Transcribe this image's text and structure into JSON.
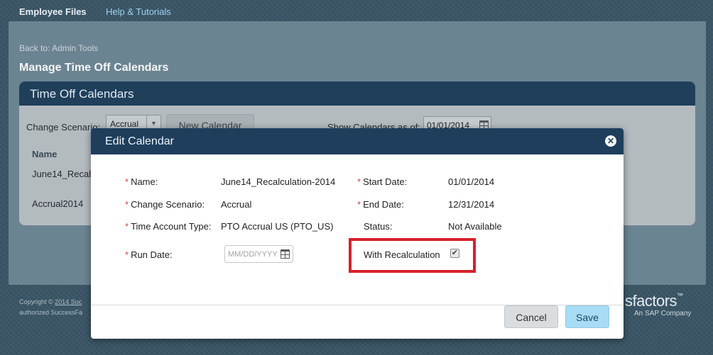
{
  "topbar": {
    "brand": "Employee Files",
    "help": "Help & Tutorials"
  },
  "page": {
    "back_link": "Back to: Admin Tools",
    "title": "Manage Time Off Calendars"
  },
  "panel": {
    "title": "Time Off Calendars",
    "change_scenario_label": "Change Scenario:",
    "change_scenario_value": "Accrual",
    "new_calendar_label": "New Calendar",
    "show_as_of_label": "Show Calendars as of:",
    "show_as_of_value": "01/01/2014",
    "name_header": "Name",
    "rows": [
      "June14_Recalc",
      "Accrual2014"
    ]
  },
  "footer": {
    "copyright_prefix": "Copyright ©",
    "copyright_link": "2014 Suc",
    "line2": "authorized SuccessFa",
    "logo_word": "sfactors",
    "logo_tagline": "An SAP Company"
  },
  "modal": {
    "title": "Edit Calendar",
    "close_glyph": "✕",
    "required_mark": "*",
    "fields": {
      "name": {
        "label": "Name:",
        "value": "June14_Recalculation-2014"
      },
      "change_scenario": {
        "label": "Change Scenario:",
        "value": "Accrual"
      },
      "time_account_type": {
        "label": "Time Account Type:",
        "value": "PTO Accrual US (PTO_US)"
      },
      "run_date": {
        "label": "Run Date:",
        "placeholder": "MM/DD/YYYY"
      },
      "start_date": {
        "label": "Start Date:",
        "value": "01/01/2014"
      },
      "end_date": {
        "label": "End Date:",
        "value": "12/31/2014"
      },
      "status": {
        "label": "Status:",
        "value": "Not Available"
      },
      "with_recalculation": {
        "label": "With Recalculation",
        "checked": true,
        "glyph": "✔"
      }
    },
    "cancel_label": "Cancel",
    "save_label": "Save"
  },
  "colors": {
    "header_navy": "#1e3e5c",
    "required_red": "#d9443c",
    "highlight_red": "#d7202a",
    "save_blue": "#a8dcf4"
  }
}
